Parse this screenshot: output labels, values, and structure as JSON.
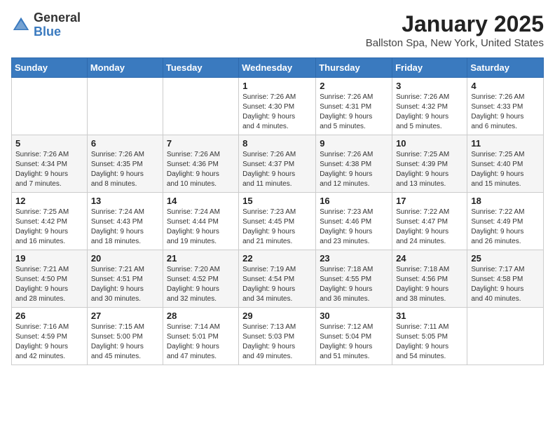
{
  "header": {
    "logo_general": "General",
    "logo_blue": "Blue",
    "month": "January 2025",
    "location": "Ballston Spa, New York, United States"
  },
  "weekdays": [
    "Sunday",
    "Monday",
    "Tuesday",
    "Wednesday",
    "Thursday",
    "Friday",
    "Saturday"
  ],
  "weeks": [
    [
      {
        "day": "",
        "info": ""
      },
      {
        "day": "",
        "info": ""
      },
      {
        "day": "",
        "info": ""
      },
      {
        "day": "1",
        "info": "Sunrise: 7:26 AM\nSunset: 4:30 PM\nDaylight: 9 hours\nand 4 minutes."
      },
      {
        "day": "2",
        "info": "Sunrise: 7:26 AM\nSunset: 4:31 PM\nDaylight: 9 hours\nand 5 minutes."
      },
      {
        "day": "3",
        "info": "Sunrise: 7:26 AM\nSunset: 4:32 PM\nDaylight: 9 hours\nand 5 minutes."
      },
      {
        "day": "4",
        "info": "Sunrise: 7:26 AM\nSunset: 4:33 PM\nDaylight: 9 hours\nand 6 minutes."
      }
    ],
    [
      {
        "day": "5",
        "info": "Sunrise: 7:26 AM\nSunset: 4:34 PM\nDaylight: 9 hours\nand 7 minutes."
      },
      {
        "day": "6",
        "info": "Sunrise: 7:26 AM\nSunset: 4:35 PM\nDaylight: 9 hours\nand 8 minutes."
      },
      {
        "day": "7",
        "info": "Sunrise: 7:26 AM\nSunset: 4:36 PM\nDaylight: 9 hours\nand 10 minutes."
      },
      {
        "day": "8",
        "info": "Sunrise: 7:26 AM\nSunset: 4:37 PM\nDaylight: 9 hours\nand 11 minutes."
      },
      {
        "day": "9",
        "info": "Sunrise: 7:26 AM\nSunset: 4:38 PM\nDaylight: 9 hours\nand 12 minutes."
      },
      {
        "day": "10",
        "info": "Sunrise: 7:25 AM\nSunset: 4:39 PM\nDaylight: 9 hours\nand 13 minutes."
      },
      {
        "day": "11",
        "info": "Sunrise: 7:25 AM\nSunset: 4:40 PM\nDaylight: 9 hours\nand 15 minutes."
      }
    ],
    [
      {
        "day": "12",
        "info": "Sunrise: 7:25 AM\nSunset: 4:42 PM\nDaylight: 9 hours\nand 16 minutes."
      },
      {
        "day": "13",
        "info": "Sunrise: 7:24 AM\nSunset: 4:43 PM\nDaylight: 9 hours\nand 18 minutes."
      },
      {
        "day": "14",
        "info": "Sunrise: 7:24 AM\nSunset: 4:44 PM\nDaylight: 9 hours\nand 19 minutes."
      },
      {
        "day": "15",
        "info": "Sunrise: 7:23 AM\nSunset: 4:45 PM\nDaylight: 9 hours\nand 21 minutes."
      },
      {
        "day": "16",
        "info": "Sunrise: 7:23 AM\nSunset: 4:46 PM\nDaylight: 9 hours\nand 23 minutes."
      },
      {
        "day": "17",
        "info": "Sunrise: 7:22 AM\nSunset: 4:47 PM\nDaylight: 9 hours\nand 24 minutes."
      },
      {
        "day": "18",
        "info": "Sunrise: 7:22 AM\nSunset: 4:49 PM\nDaylight: 9 hours\nand 26 minutes."
      }
    ],
    [
      {
        "day": "19",
        "info": "Sunrise: 7:21 AM\nSunset: 4:50 PM\nDaylight: 9 hours\nand 28 minutes."
      },
      {
        "day": "20",
        "info": "Sunrise: 7:21 AM\nSunset: 4:51 PM\nDaylight: 9 hours\nand 30 minutes."
      },
      {
        "day": "21",
        "info": "Sunrise: 7:20 AM\nSunset: 4:52 PM\nDaylight: 9 hours\nand 32 minutes."
      },
      {
        "day": "22",
        "info": "Sunrise: 7:19 AM\nSunset: 4:54 PM\nDaylight: 9 hours\nand 34 minutes."
      },
      {
        "day": "23",
        "info": "Sunrise: 7:18 AM\nSunset: 4:55 PM\nDaylight: 9 hours\nand 36 minutes."
      },
      {
        "day": "24",
        "info": "Sunrise: 7:18 AM\nSunset: 4:56 PM\nDaylight: 9 hours\nand 38 minutes."
      },
      {
        "day": "25",
        "info": "Sunrise: 7:17 AM\nSunset: 4:58 PM\nDaylight: 9 hours\nand 40 minutes."
      }
    ],
    [
      {
        "day": "26",
        "info": "Sunrise: 7:16 AM\nSunset: 4:59 PM\nDaylight: 9 hours\nand 42 minutes."
      },
      {
        "day": "27",
        "info": "Sunrise: 7:15 AM\nSunset: 5:00 PM\nDaylight: 9 hours\nand 45 minutes."
      },
      {
        "day": "28",
        "info": "Sunrise: 7:14 AM\nSunset: 5:01 PM\nDaylight: 9 hours\nand 47 minutes."
      },
      {
        "day": "29",
        "info": "Sunrise: 7:13 AM\nSunset: 5:03 PM\nDaylight: 9 hours\nand 49 minutes."
      },
      {
        "day": "30",
        "info": "Sunrise: 7:12 AM\nSunset: 5:04 PM\nDaylight: 9 hours\nand 51 minutes."
      },
      {
        "day": "31",
        "info": "Sunrise: 7:11 AM\nSunset: 5:05 PM\nDaylight: 9 hours\nand 54 minutes."
      },
      {
        "day": "",
        "info": ""
      }
    ]
  ]
}
